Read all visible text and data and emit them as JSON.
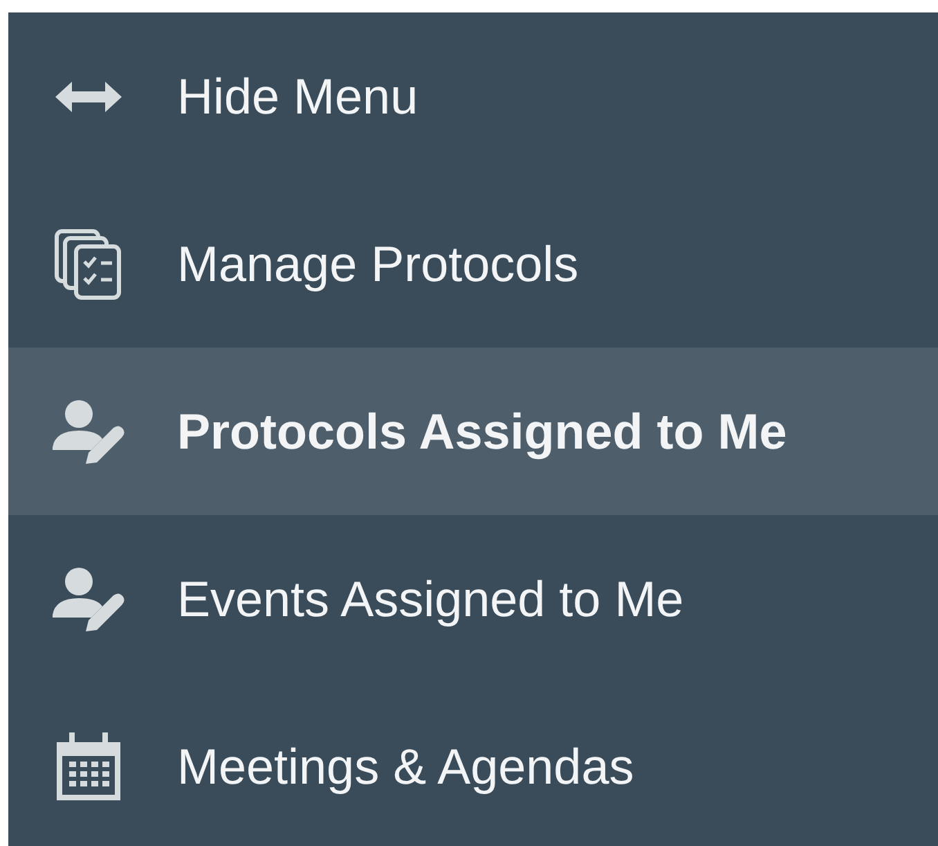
{
  "menu": {
    "items": [
      {
        "label": "Hide Menu",
        "kind": "arrows",
        "selected": false
      },
      {
        "label": "Manage Protocols",
        "kind": "checklists",
        "selected": false
      },
      {
        "label": "Protocols Assigned to Me",
        "kind": "user-edit",
        "selected": true
      },
      {
        "label": "Events Assigned to Me",
        "kind": "user-edit",
        "selected": false
      },
      {
        "label": "Meetings & Agendas",
        "kind": "calendar",
        "selected": false
      }
    ]
  }
}
